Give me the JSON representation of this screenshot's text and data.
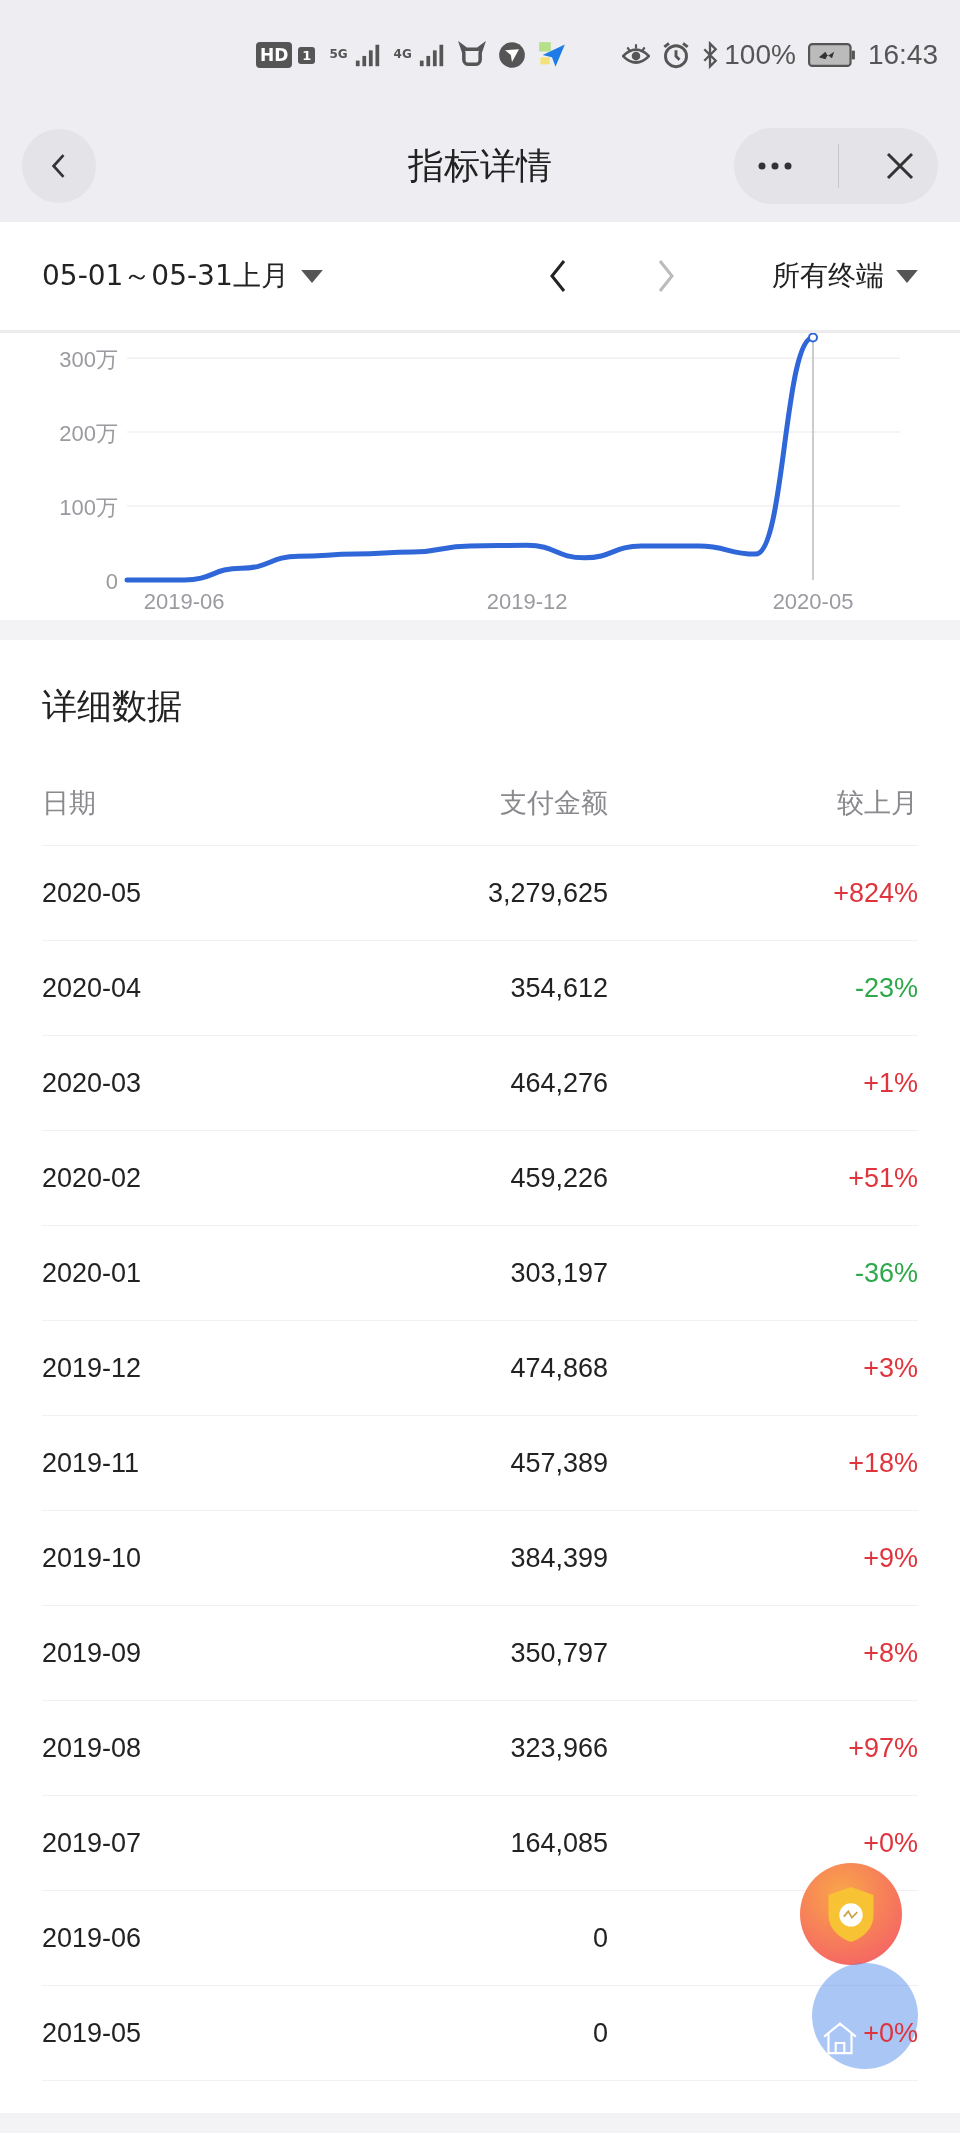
{
  "status_bar": {
    "hd": "HD",
    "sim": "1",
    "networks": [
      "5G",
      "4G"
    ],
    "battery": "100%",
    "time": "16:43"
  },
  "header": {
    "title": "指标详情"
  },
  "filter": {
    "date_range": "05-01～05-31上月",
    "prev_disabled": false,
    "next_disabled": true,
    "terminal": "所有终端"
  },
  "chart": {
    "chart_data": {
      "type": "line",
      "categories": [
        null,
        "2019-06",
        null,
        null,
        null,
        null,
        null,
        "2019-12",
        null,
        null,
        null,
        null,
        "2020-05"
      ],
      "series": [
        {
          "color": "#2f66d8",
          "values": [
            0,
            0,
            16,
            32,
            35,
            38,
            46,
            47,
            30,
            46,
            46,
            35,
            328
          ]
        }
      ],
      "ylim": [
        0,
        330
      ],
      "grid": true,
      "yticks": [
        {
          "value": 0,
          "label": "0"
        },
        {
          "value": 100,
          "label": "100万"
        },
        {
          "value": 200,
          "label": "200万"
        },
        {
          "value": 300,
          "label": "300万"
        }
      ]
    }
  },
  "details": {
    "title": "详细数据",
    "columns": [
      "日期",
      "支付金额",
      "较上月"
    ],
    "rows": [
      {
        "date": "2020-05",
        "amount": "3,279,625",
        "change": "+824%",
        "color": "#e0343d"
      },
      {
        "date": "2020-04",
        "amount": "354,612",
        "change": "-23%",
        "color": "#2ea84a"
      },
      {
        "date": "2020-03",
        "amount": "464,276",
        "change": "+1%",
        "color": "#e0343d"
      },
      {
        "date": "2020-02",
        "amount": "459,226",
        "change": "+51%",
        "color": "#e0343d"
      },
      {
        "date": "2020-01",
        "amount": "303,197",
        "change": "-36%",
        "color": "#2ea84a"
      },
      {
        "date": "2019-12",
        "amount": "474,868",
        "change": "+3%",
        "color": "#e0343d"
      },
      {
        "date": "2019-11",
        "amount": "457,389",
        "change": "+18%",
        "color": "#e0343d"
      },
      {
        "date": "2019-10",
        "amount": "384,399",
        "change": "+9%",
        "color": "#e0343d"
      },
      {
        "date": "2019-09",
        "amount": "350,797",
        "change": "+8%",
        "color": "#e0343d"
      },
      {
        "date": "2019-08",
        "amount": "323,966",
        "change": "+97%",
        "color": "#e0343d"
      },
      {
        "date": "2019-07",
        "amount": "164,085",
        "change": "+0%",
        "color": "#e0343d"
      },
      {
        "date": "2019-06",
        "amount": "0"
      },
      {
        "date": "2019-05",
        "amount": "0",
        "change": "+0%",
        "color": "#e0343d"
      }
    ]
  }
}
